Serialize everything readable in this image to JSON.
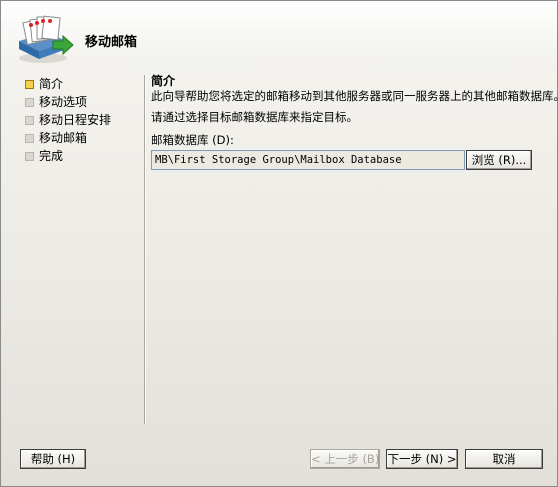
{
  "header": {
    "title": "移动邮箱",
    "icon": "mail-move-wizard-icon"
  },
  "steps": [
    {
      "label": "简介",
      "active": true
    },
    {
      "label": "移动选项",
      "active": false
    },
    {
      "label": "移动日程安排",
      "active": false
    },
    {
      "label": "移动邮箱",
      "active": false
    },
    {
      "label": "完成",
      "active": false
    }
  ],
  "content": {
    "section_title": "简介",
    "description": "此向导帮助您将选定的邮箱移动到其他服务器或同一服务器上的其他邮箱数据库。",
    "hint": "请通过选择目标邮箱数据库来指定目标。",
    "db_label": "邮箱数据库 (D):",
    "db_value": "MB\\First Storage Group\\Mailbox Database",
    "browse_label": "浏览 (R)..."
  },
  "footer": {
    "help_label": "帮助 (H)",
    "back_label": "< 上一步 (B)",
    "next_label": "下一步 (N) >",
    "cancel_label": "取消"
  },
  "colors": {
    "active_step": "#f3d24a",
    "accent_green": "#3aa63a"
  }
}
